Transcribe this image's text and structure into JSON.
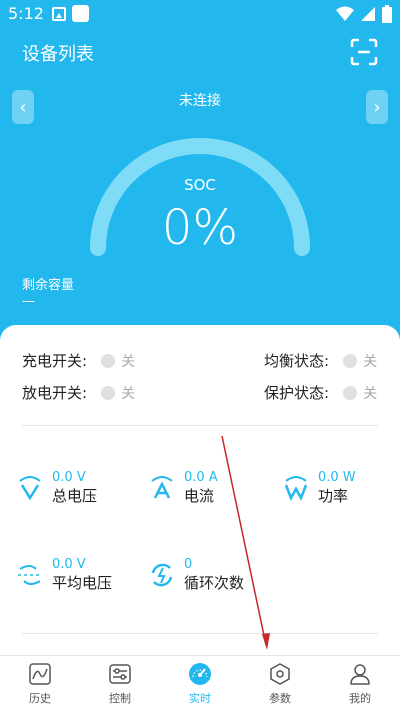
{
  "status": {
    "time": "5:12"
  },
  "header": {
    "title": "设备列表",
    "connection": "未连接"
  },
  "gauge": {
    "label": "SOC",
    "value": "0%",
    "fraction": 0.0
  },
  "remaining": {
    "label": "剩余容量",
    "value": "—"
  },
  "switches": [
    {
      "label": "充电开关:",
      "state": "关"
    },
    {
      "label": "放电开关:",
      "state": "关"
    },
    {
      "label": "均衡状态:",
      "state": "关"
    },
    {
      "label": "保护状态:",
      "state": "关"
    }
  ],
  "metrics": [
    {
      "value": "0.0 V",
      "label": "总电压",
      "icon": "voltage-icon"
    },
    {
      "value": "0.0 A",
      "label": "电流",
      "icon": "current-icon"
    },
    {
      "value": "0.0 W",
      "label": "功率",
      "icon": "power-icon"
    },
    {
      "value": "0.0 V",
      "label": "平均电压",
      "icon": "avg-voltage-icon"
    },
    {
      "value": "0",
      "label": "循环次数",
      "icon": "cycle-count-icon"
    }
  ],
  "tabs": [
    {
      "label": "历史",
      "icon": "history-chart-icon"
    },
    {
      "label": "控制",
      "icon": "control-sliders-icon"
    },
    {
      "label": "实时",
      "icon": "realtime-gauge-icon",
      "active": true
    },
    {
      "label": "参数",
      "icon": "settings-hex-icon"
    },
    {
      "label": "我的",
      "icon": "user-icon"
    }
  ],
  "colors": {
    "primary": "#22b8ee",
    "gauge_track": "#7fdcf7",
    "annotation_arrow": "#c62828"
  }
}
